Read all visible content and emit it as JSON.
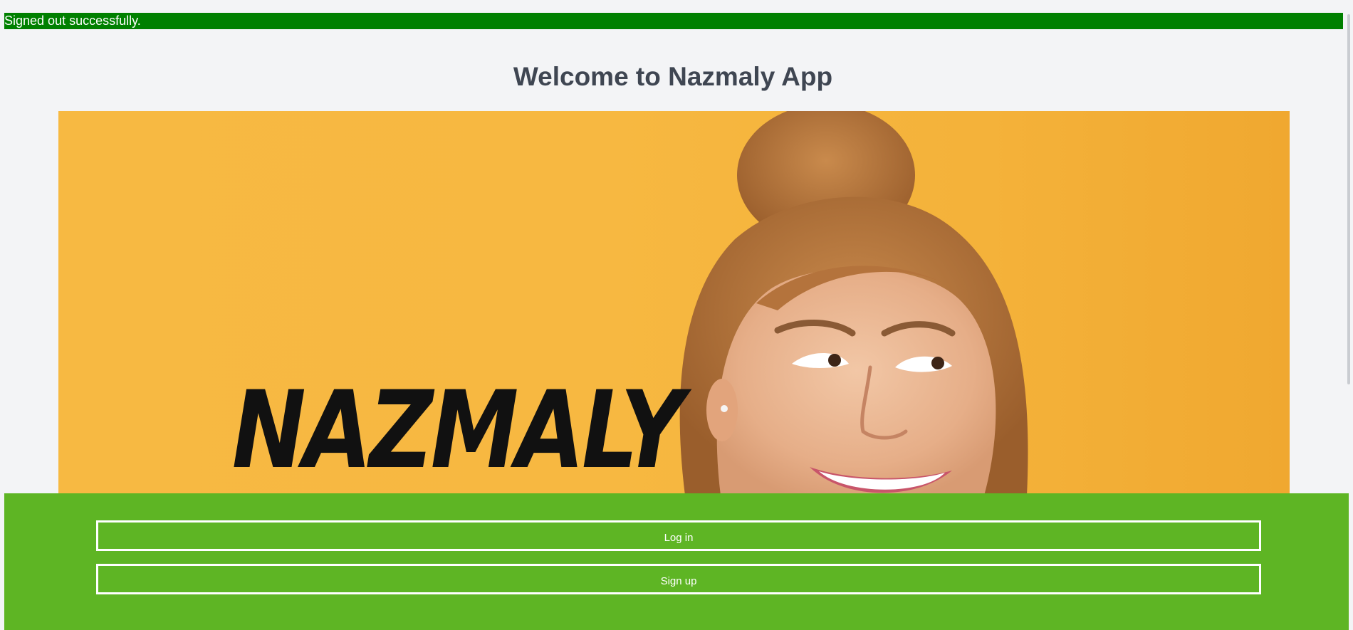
{
  "flash": {
    "message": "Signed out successfully.",
    "color": "#008000"
  },
  "page": {
    "title": "Welcome to Nazmaly App"
  },
  "hero": {
    "logo_text": "NAZMALY",
    "background_color": "#f7b942"
  },
  "footer": {
    "background_color": "#5eb524",
    "login_label": "Log in",
    "signup_label": "Sign up"
  }
}
